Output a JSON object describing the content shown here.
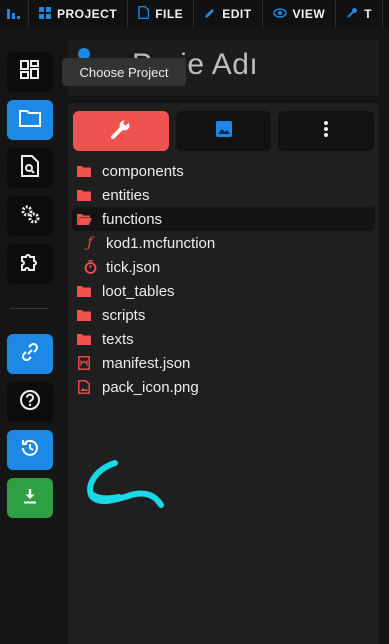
{
  "menubar": {
    "items": [
      {
        "label": "PROJECT",
        "icon": "grid-icon"
      },
      {
        "label": "FILE",
        "icon": "file-icon"
      },
      {
        "label": "EDIT",
        "icon": "pencil-icon"
      },
      {
        "label": "VIEW",
        "icon": "eye-icon"
      },
      {
        "label": "T",
        "icon": "wrench-icon"
      }
    ]
  },
  "sidebar": {
    "buttons": [
      "dashboard-icon",
      "folder-icon",
      "file-search-icon",
      "gears-icon",
      "puzzle-icon",
      "link-icon",
      "help-icon",
      "history-icon",
      "download-icon"
    ],
    "active": "folder-icon"
  },
  "project": {
    "title": "Proje Adı",
    "tooltip": "Choose Project"
  },
  "panel": {
    "tabs": [
      "wrench-icon",
      "image-icon",
      "more-vert-icon"
    ],
    "active_tab": "wrench-icon",
    "tree": [
      {
        "name": "components",
        "type": "folder"
      },
      {
        "name": "entities",
        "type": "folder"
      },
      {
        "name": "functions",
        "type": "folder-open",
        "selected": true
      },
      {
        "name": "kod1.mcfunction",
        "type": "function-file"
      },
      {
        "name": "tick.json",
        "type": "timer-file"
      },
      {
        "name": "loot_tables",
        "type": "folder"
      },
      {
        "name": "scripts",
        "type": "folder"
      },
      {
        "name": "texts",
        "type": "folder"
      },
      {
        "name": "manifest.json",
        "type": "manifest-file"
      },
      {
        "name": "pack_icon.png",
        "type": "image-file"
      }
    ]
  },
  "colors": {
    "accent_blue": "#1e88e5",
    "accent_red": "#ef5350",
    "accent_green": "#2ea043",
    "annotation_cyan": "#19d9e6"
  }
}
